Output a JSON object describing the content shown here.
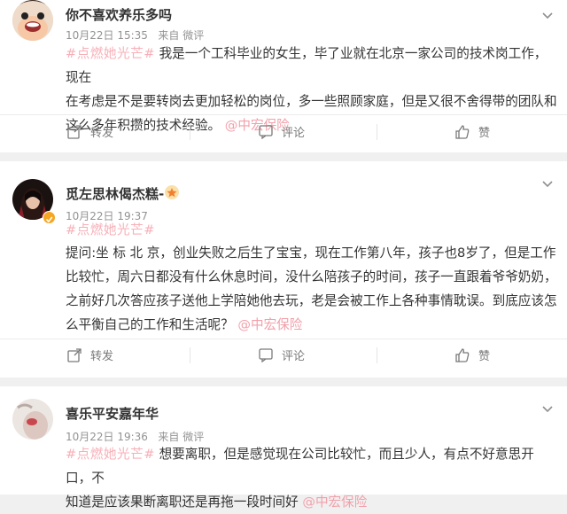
{
  "posts": [
    {
      "username": "你不喜欢养乐多吗",
      "date": "10月22日 15:35",
      "source_prefix": "来自",
      "source": "微评",
      "tag": "#点燃她光芒#",
      "lines": [
        "我是一个工科毕业的女生，毕了业就在北京一家公司的技术岗工作，现在",
        "在考虑是不是要转岗去更加轻松的岗位，多一些照顾家庭，但是又很不舍得带的团队和",
        "这么多年积攒的技术经验。"
      ],
      "mention": "@中宏保险",
      "actions": {
        "repost": "转发",
        "comment": "评论",
        "like": "赞"
      },
      "avatar_icon": "cartoon-avatar"
    },
    {
      "username": "觅左思林偈杰糕-",
      "date": "10月22日 19:37",
      "tag": "#点燃她光芒#",
      "lines": [
        "提问:坐 标 北 京，创业失败之后生了宝宝，现在工作第八年，孩子也8岁了，但是工作",
        "比较忙，周六日都没有什么休息时间，没什么陪孩子的时间，孩子一直跟着爷爷奶奶，",
        "之前好几次答应孩子送他上学陪她他去玩，老是会被工作上各种事情耽误。到底应该怎",
        "么平衡自己的工作和生活呢？"
      ],
      "mention": "@中宏保险",
      "actions": {
        "repost": "转发",
        "comment": "评论",
        "like": "赞"
      },
      "avatar_icon": "photo-avatar"
    },
    {
      "username": "喜乐平安嘉年华",
      "date": "10月22日 19:36",
      "source_prefix": "来自",
      "source": "微评",
      "tag": "#点燃她光芒#",
      "lines": [
        "想要离职，但是感觉现在公司比较忙，而且少人，有点不好意思开口，不",
        "知道是应该果断离职还是再拖一段时间好"
      ],
      "mention": "@中宏保险",
      "avatar_icon": "photo-avatar"
    }
  ],
  "colors": {
    "tag": "#f7b0b8",
    "meta": "#939393",
    "gold_badge": "#f5a623"
  }
}
